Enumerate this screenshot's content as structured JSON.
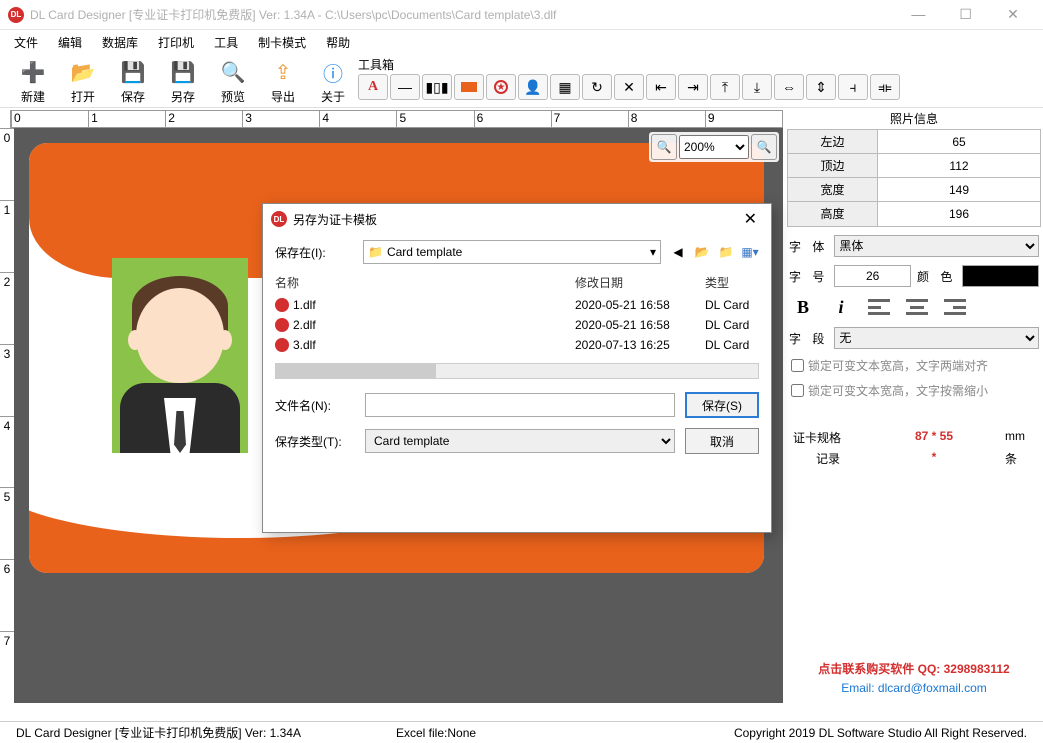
{
  "title": "DL Card Designer [专业证卡打印机免费版] Ver: 1.34A - C:\\Users\\pc\\Documents\\Card template\\3.dlf",
  "menu": [
    "文件",
    "编辑",
    "数据库",
    "打印机",
    "工具",
    "制卡模式",
    "帮助"
  ],
  "tools": [
    {
      "label": "新建",
      "color": "#4caf50",
      "glyph": "＋"
    },
    {
      "label": "打开",
      "color": "#e99a3a",
      "glyph": "📂"
    },
    {
      "label": "保存",
      "color": "#36648b",
      "glyph": "💾"
    },
    {
      "label": "另存",
      "color": "#36648b",
      "glyph": "💾"
    },
    {
      "label": "预览",
      "color": "#555",
      "glyph": "🔍"
    },
    {
      "label": "导出",
      "color": "#e99a3a",
      "glyph": "⇪"
    },
    {
      "label": "关于",
      "color": "#1e88e5",
      "glyph": "ⓘ"
    }
  ],
  "toolbox_label": "工具箱",
  "ruler_h": [
    "0",
    "1",
    "2",
    "3",
    "4",
    "5",
    "6",
    "7",
    "8",
    "9"
  ],
  "ruler_v": [
    "0",
    "1",
    "2",
    "3",
    "4",
    "5",
    "6",
    "7"
  ],
  "zoom": "200%",
  "photo_info_title": "照片信息",
  "info": {
    "left_k": "左边",
    "left_v": "65",
    "top_k": "顶边",
    "top_v": "112",
    "width_k": "宽度",
    "width_v": "149",
    "height_k": "高度",
    "height_v": "196"
  },
  "font_label": "字 体",
  "font_value": "黑体",
  "size_label": "字 号",
  "size_value": "26",
  "color_label": "颜 色",
  "field_label": "字 段",
  "field_value": "无",
  "chk1": "锁定可变文本宽高，文字两端对齐",
  "chk2": "锁定可变文本宽高，文字按需缩小",
  "spec_label": "证卡规格",
  "spec_value": "87 * 55",
  "spec_unit": "mm",
  "rec_label": "记录",
  "rec_value": "*",
  "rec_unit": "条",
  "contact1": "点击联系购买软件 QQ: 3298983112",
  "contact2": "Email: dlcard@foxmail.com",
  "status": {
    "left": "DL Card Designer [专业证卡打印机免费版] Ver: 1.34A",
    "mid": "Excel file:None",
    "right": "Copyright 2019 DL Software Studio All Right Reserved."
  },
  "dialog": {
    "title": "另存为证卡模板",
    "save_in_label": "保存在(I):",
    "folder": "Card template",
    "hdr_name": "名称",
    "hdr_date": "修改日期",
    "hdr_type": "类型",
    "files": [
      {
        "name": "1.dlf",
        "date": "2020-05-21 16:58",
        "type": "DL Card"
      },
      {
        "name": "2.dlf",
        "date": "2020-05-21 16:58",
        "type": "DL Card"
      },
      {
        "name": "3.dlf",
        "date": "2020-07-13 16:25",
        "type": "DL Card"
      }
    ],
    "filename_label": "文件名(N):",
    "filename_value": "",
    "savetype_label": "保存类型(T):",
    "savetype_value": "Card template",
    "save_btn": "保存(S)",
    "cancel_btn": "取消"
  }
}
